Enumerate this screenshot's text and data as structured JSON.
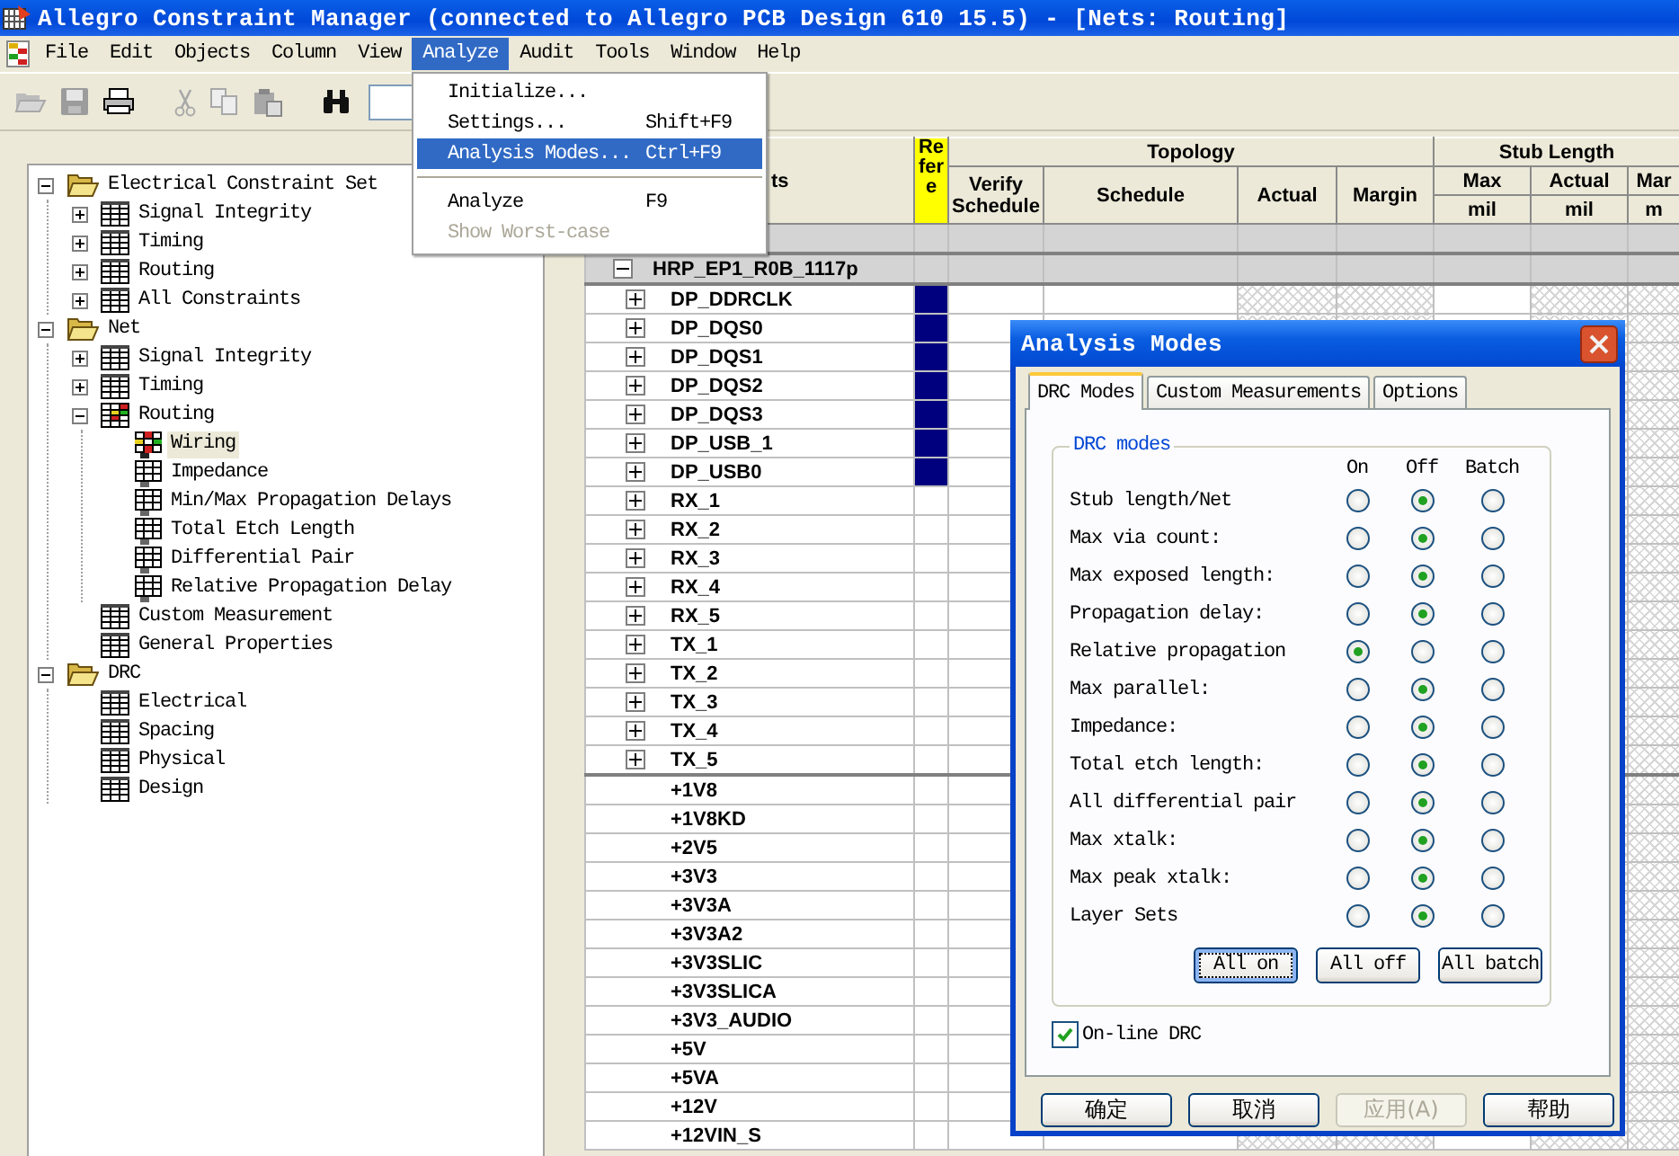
{
  "window": {
    "title": "Allegro Constraint Manager (connected to Allegro PCB Design 610 15.5) - [Nets:  Routing]"
  },
  "menubar": [
    {
      "label": "File",
      "selected": false
    },
    {
      "label": "Edit",
      "selected": false
    },
    {
      "label": "Objects",
      "selected": false
    },
    {
      "label": "Column",
      "selected": false
    },
    {
      "label": "View",
      "selected": false
    },
    {
      "label": "Analyze",
      "selected": true
    },
    {
      "label": "Audit",
      "selected": false
    },
    {
      "label": "Tools",
      "selected": false
    },
    {
      "label": "Window",
      "selected": false
    },
    {
      "label": "Help",
      "selected": false
    }
  ],
  "analyze_menu": [
    {
      "kind": "item",
      "label": "Initialize...",
      "selected": false,
      "disabled": false
    },
    {
      "kind": "item",
      "label": "Settings...",
      "shortcut": "Shift+F9",
      "selected": false,
      "disabled": false
    },
    {
      "kind": "item",
      "label": "Analysis Modes...",
      "shortcut": "Ctrl+F9",
      "selected": true,
      "disabled": false
    },
    {
      "kind": "separator"
    },
    {
      "kind": "item",
      "label": "Analyze",
      "shortcut": "F9",
      "selected": false,
      "disabled": false
    },
    {
      "kind": "item",
      "label": "Show Worst-case",
      "selected": false,
      "disabled": true
    }
  ],
  "tree": [
    {
      "label": "Electrical Constraint Set",
      "kind": "folder",
      "expanded": true,
      "selected": false,
      "children": [
        {
          "label": "Signal Integrity",
          "kind": "workbook",
          "expanded": false,
          "selected": false
        },
        {
          "label": "Timing",
          "kind": "workbook",
          "expanded": false,
          "selected": false
        },
        {
          "label": "Routing",
          "kind": "workbook",
          "expanded": false,
          "selected": false
        },
        {
          "label": "All Constraints",
          "kind": "workbook",
          "expanded": false,
          "selected": false
        }
      ]
    },
    {
      "label": "Net",
      "kind": "folder",
      "expanded": true,
      "selected": false,
      "children": [
        {
          "label": "Signal Integrity",
          "kind": "workbook",
          "expanded": false,
          "selected": false
        },
        {
          "label": "Timing",
          "kind": "workbook",
          "expanded": false,
          "selected": false
        },
        {
          "label": "Routing",
          "kind": "workbook-status",
          "expanded": true,
          "selected": false,
          "children": [
            {
              "label": "Wiring",
              "kind": "worksheet-status",
              "selected": true
            },
            {
              "label": "Impedance",
              "kind": "worksheet",
              "selected": false
            },
            {
              "label": "Min/Max Propagation Delays",
              "kind": "worksheet",
              "selected": false
            },
            {
              "label": "Total Etch Length",
              "kind": "worksheet",
              "selected": false
            },
            {
              "label": "Differential Pair",
              "kind": "worksheet",
              "selected": false
            },
            {
              "label": "Relative Propagation Delay",
              "kind": "worksheet",
              "selected": false
            }
          ]
        },
        {
          "label": "Custom Measurement",
          "kind": "workbook",
          "selected": false
        },
        {
          "label": "General Properties",
          "kind": "workbook",
          "selected": false
        }
      ]
    },
    {
      "label": "DRC",
      "kind": "folder",
      "expanded": true,
      "selected": false,
      "children": [
        {
          "label": "Electrical",
          "kind": "workbook",
          "selected": false
        },
        {
          "label": "Spacing",
          "kind": "workbook",
          "selected": false
        },
        {
          "label": "Physical",
          "kind": "workbook",
          "selected": false
        },
        {
          "label": "Design",
          "kind": "workbook",
          "selected": false
        }
      ]
    }
  ],
  "worksheet": {
    "objects_header": "ts",
    "reference_header": "Refere",
    "groups": [
      {
        "label": "Topology",
        "columns": [
          {
            "label": "Verify Schedule",
            "hatched": false
          },
          {
            "label": "Schedule",
            "hatched": false
          },
          {
            "label": "Actual",
            "hatched": true
          },
          {
            "label": "Margin",
            "hatched": true
          }
        ]
      },
      {
        "label": "Stub Length",
        "columns": [
          {
            "label": "Max",
            "unit": "mil",
            "hatched": false
          },
          {
            "label": "Actual",
            "unit": "mil",
            "hatched": true
          },
          {
            "label": "Mar",
            "unit": "m",
            "hatched": true
          }
        ]
      }
    ],
    "rows": [
      {
        "name": "HRP_EP1_R0B_1117p",
        "expanded": true,
        "children": [
          {
            "name": "DP_DDRCLK",
            "expanded": false,
            "color": "#00007f"
          },
          {
            "name": "DP_DQS0",
            "expanded": false,
            "color": "#00007f"
          },
          {
            "name": "DP_DQS1",
            "expanded": false,
            "color": "#00007f"
          },
          {
            "name": "DP_DQS2",
            "expanded": false,
            "color": "#00007f"
          },
          {
            "name": "DP_DQS3",
            "expanded": false,
            "color": "#00007f"
          },
          {
            "name": "DP_USB_1",
            "expanded": false,
            "color": "#00007f"
          },
          {
            "name": "DP_USB0",
            "expanded": false,
            "color": "#00007f"
          },
          {
            "name": "RX_1",
            "expanded": false
          },
          {
            "name": "RX_2",
            "expanded": false
          },
          {
            "name": "RX_3",
            "expanded": false
          },
          {
            "name": "RX_4",
            "expanded": false
          },
          {
            "name": "RX_5",
            "expanded": false
          },
          {
            "name": "TX_1",
            "expanded": false
          },
          {
            "name": "TX_2",
            "expanded": false
          },
          {
            "name": "TX_3",
            "expanded": false
          },
          {
            "name": "TX_4",
            "expanded": false
          },
          {
            "name": "TX_5",
            "expanded": false
          },
          {
            "name": "+1V8"
          },
          {
            "name": "+1V8KD"
          },
          {
            "name": "+2V5"
          },
          {
            "name": "+3V3"
          },
          {
            "name": "+3V3A"
          },
          {
            "name": "+3V3A2"
          },
          {
            "name": "+3V3SLIC"
          },
          {
            "name": "+3V3SLICA"
          },
          {
            "name": "+3V3_AUDIO"
          },
          {
            "name": "+5V"
          },
          {
            "name": "+5VA"
          },
          {
            "name": "+12V"
          },
          {
            "name": "+12VIN_S"
          }
        ]
      }
    ]
  },
  "dialog": {
    "title": "Analysis Modes",
    "tabs": [
      {
        "label": "DRC Modes",
        "selected": true
      },
      {
        "label": "Custom Measurements",
        "selected": false
      },
      {
        "label": "Options",
        "selected": false
      }
    ],
    "group": {
      "title": "DRC modes",
      "columns": [
        "On",
        "Off",
        "Batch"
      ],
      "rows": [
        {
          "label": "Stub length/Net",
          "choices": [
            {
              "selected": false
            },
            {
              "selected": true
            },
            {
              "selected": false
            }
          ]
        },
        {
          "label": "Max via count:",
          "choices": [
            {
              "selected": false
            },
            {
              "selected": true
            },
            {
              "selected": false
            }
          ]
        },
        {
          "label": "Max exposed length:",
          "choices": [
            {
              "selected": false
            },
            {
              "selected": true
            },
            {
              "selected": false
            }
          ]
        },
        {
          "label": "Propagation delay:",
          "choices": [
            {
              "selected": false
            },
            {
              "selected": true
            },
            {
              "selected": false
            }
          ]
        },
        {
          "label": "Relative propagation",
          "choices": [
            {
              "selected": true
            },
            {
              "selected": false
            },
            {
              "selected": false
            }
          ]
        },
        {
          "label": "Max parallel:",
          "choices": [
            {
              "selected": false
            },
            {
              "selected": true
            },
            {
              "selected": false
            }
          ]
        },
        {
          "label": "Impedance:",
          "choices": [
            {
              "selected": false
            },
            {
              "selected": true
            },
            {
              "selected": false
            }
          ]
        },
        {
          "label": "Total etch length:",
          "choices": [
            {
              "selected": false
            },
            {
              "selected": true
            },
            {
              "selected": false
            }
          ]
        },
        {
          "label": "All differential pair",
          "choices": [
            {
              "selected": false
            },
            {
              "selected": true
            },
            {
              "selected": false
            }
          ]
        },
        {
          "label": "Max xtalk:",
          "choices": [
            {
              "selected": false
            },
            {
              "selected": true
            },
            {
              "selected": false
            }
          ]
        },
        {
          "label": "Max peak xtalk:",
          "choices": [
            {
              "selected": false
            },
            {
              "selected": true
            },
            {
              "selected": false
            }
          ]
        },
        {
          "label": "Layer Sets",
          "choices": [
            {
              "selected": false
            },
            {
              "selected": true
            },
            {
              "selected": false
            }
          ]
        }
      ],
      "buttons": [
        {
          "label": "All on",
          "focused": true
        },
        {
          "label": "All off",
          "focused": false
        },
        {
          "label": "All batch",
          "focused": false
        }
      ]
    },
    "checkbox": {
      "label": "On-line DRC",
      "checked": true
    },
    "buttons": [
      {
        "label": "确定",
        "disabled": false
      },
      {
        "label": "取消",
        "disabled": false
      },
      {
        "label": "应用(A)",
        "disabled": true
      },
      {
        "label": "帮助",
        "disabled": false
      }
    ]
  }
}
